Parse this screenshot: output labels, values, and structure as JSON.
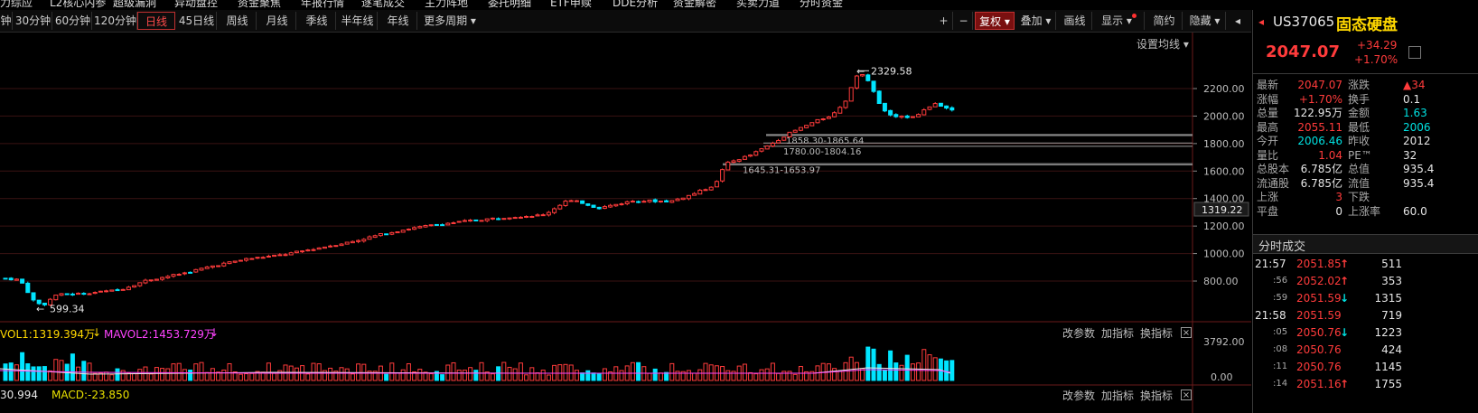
{
  "top_menu": [
    "力综应",
    "L2核心内参",
    "超级漏洞",
    "异动盘控",
    "资金聚焦",
    "年报行情",
    "逐笔成交",
    "主力阵地",
    "委托明细",
    "ETF申赎",
    "DDE分析",
    "资金解密",
    "买卖力道",
    "分时资金"
  ],
  "toolbar": {
    "periods": [
      "钟",
      "30分钟",
      "60分钟",
      "120分钟",
      "日线",
      "45日线",
      "周线",
      "月线",
      "季线",
      "半年线",
      "年线",
      "更多周期"
    ],
    "active_period": "日线",
    "plus": "+",
    "minus": "−",
    "fuquan": "复权",
    "overlay": "叠加",
    "draw": "画线",
    "display": "显示",
    "simple": "简约",
    "hide": "隐藏",
    "prev_arrow": "◂"
  },
  "chart": {
    "settings_label": "设置均线",
    "y_ticks": [
      "2200.00",
      "2000.00",
      "1800.00",
      "1600.00",
      "1400.00",
      "1200.00",
      "1000.00",
      "800.00"
    ],
    "y_tick_values": [
      2200,
      2000,
      1800,
      1600,
      1400,
      1200,
      1000,
      800
    ],
    "current_price_tag": "1319.22",
    "high_label": "2329.58",
    "low_label": "599.34",
    "gap_labels": [
      "1858.30-1865.64",
      "1780.00-1804.16",
      "1645.31-1653.97"
    ]
  },
  "volume_panel": {
    "vol1": "VOL1:1319.394万",
    "vol2": "MAVOL2:1453.729万",
    "controls": [
      "改参数",
      "加指标",
      "换指标"
    ],
    "y_ticks": [
      "3792.00",
      "0.00"
    ],
    "macd_left": "30.994",
    "macd": "MACD:-23.850",
    "close": "×"
  },
  "quote": {
    "code": "US37065",
    "name": "固态硬盘",
    "price": "2047.07",
    "change": "+34.29",
    "change_pct": "+1.70%",
    "rows": [
      {
        "l1": "最新",
        "v1": "2047.07",
        "c1": "red",
        "l2": "涨跌",
        "v2": "▲34",
        "c2": "red"
      },
      {
        "l1": "涨幅",
        "v1": "+1.70%",
        "c1": "red",
        "l2": "换手",
        "v2": "0.1",
        "c2": "white"
      },
      {
        "l1": "总量",
        "v1": "122.95万",
        "c1": "white",
        "l2": "金额",
        "v2": "1.63",
        "c2": "green"
      },
      {
        "l1": "最高",
        "v1": "2055.11",
        "c1": "red",
        "l2": "最低",
        "v2": "2006",
        "c2": "green"
      },
      {
        "l1": "今开",
        "v1": "2006.46",
        "c1": "green",
        "l2": "昨收",
        "v2": "2012",
        "c2": "white"
      },
      {
        "l1": "量比",
        "v1": "1.04",
        "c1": "red",
        "l2": "PE™",
        "v2": "32",
        "c2": "white"
      },
      {
        "l1": "总股本",
        "v1": "6.785亿",
        "c1": "white",
        "l2": "总值",
        "v2": "935.4",
        "c2": "white"
      },
      {
        "l1": "流通股",
        "v1": "6.785亿",
        "c1": "white",
        "l2": "流值",
        "v2": "935.4",
        "c2": "white"
      },
      {
        "l1": "上涨",
        "v1": "3",
        "c1": "red",
        "l2": "下跌",
        "v2": "",
        "c2": "white"
      },
      {
        "l1": "平盘",
        "v1": "0",
        "c1": "white",
        "l2": "上涨率",
        "v2": "60.0",
        "c2": "white"
      }
    ]
  },
  "ticks": {
    "title": "分时成交",
    "rows": [
      {
        "time": "21:57",
        "price": "2051.85",
        "pc": "red",
        "arrow": "↑",
        "ac": "red",
        "vol": "511"
      },
      {
        "time": ":56",
        "price": "2052.02",
        "pc": "red",
        "arrow": "↑",
        "ac": "red",
        "vol": "353"
      },
      {
        "time": ":59",
        "price": "2051.59",
        "pc": "red",
        "arrow": "↓",
        "ac": "green",
        "vol": "1315"
      },
      {
        "time": "21:58",
        "price": "2051.59",
        "pc": "red",
        "arrow": "",
        "ac": "red",
        "vol": "719"
      },
      {
        "time": ":05",
        "price": "2050.76",
        "pc": "red",
        "arrow": "↓",
        "ac": "green",
        "vol": "1223"
      },
      {
        "time": ":08",
        "price": "2050.76",
        "pc": "red",
        "arrow": "",
        "ac": "red",
        "vol": "424"
      },
      {
        "time": ":11",
        "price": "2050.76",
        "pc": "red",
        "arrow": "",
        "ac": "red",
        "vol": "1145"
      },
      {
        "time": ":14",
        "price": "2051.16",
        "pc": "red",
        "arrow": "↑",
        "ac": "red",
        "vol": "1755"
      }
    ]
  },
  "colors": {
    "up": "#ff3b3b",
    "down": "#00e5ff",
    "bg": "#000000",
    "grid": "#3a1212",
    "vol_ma1": "#e8e8e8",
    "vol_ma2": "#ff44ff",
    "macd": "#e8e000"
  }
}
